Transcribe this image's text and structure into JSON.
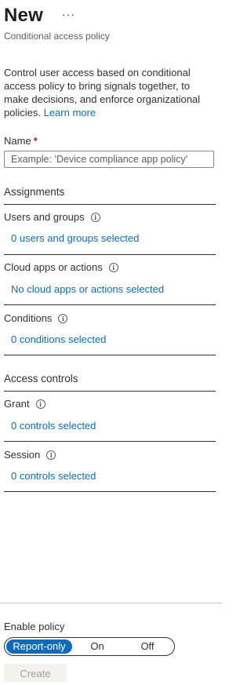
{
  "header": {
    "title": "New",
    "more_label": "···",
    "subtitle": "Conditional access policy"
  },
  "intro": {
    "description": "Control user access based on conditional access policy to bring signals together, to make decisions, and enforce organizational policies.",
    "learn_more": "Learn more"
  },
  "name_field": {
    "label": "Name",
    "required_mark": "*",
    "placeholder": "Example: 'Device compliance app policy'",
    "value": ""
  },
  "assignments": {
    "heading": "Assignments",
    "items": [
      {
        "label": "Users and groups",
        "link": "0 users and groups selected"
      },
      {
        "label": "Cloud apps or actions",
        "link": "No cloud apps or actions selected"
      },
      {
        "label": "Conditions",
        "link": "0 conditions selected"
      }
    ]
  },
  "access_controls": {
    "heading": "Access controls",
    "items": [
      {
        "label": "Grant",
        "link": "0 controls selected"
      },
      {
        "label": "Session",
        "link": "0 controls selected"
      }
    ]
  },
  "footer": {
    "enable_label": "Enable policy",
    "options": [
      "Report-only",
      "On",
      "Off"
    ],
    "selected": "Report-only",
    "create_label": "Create"
  },
  "icons": {
    "info": "info-icon"
  },
  "colors": {
    "accent": "#0f6cbd",
    "required": "#a4262c"
  }
}
